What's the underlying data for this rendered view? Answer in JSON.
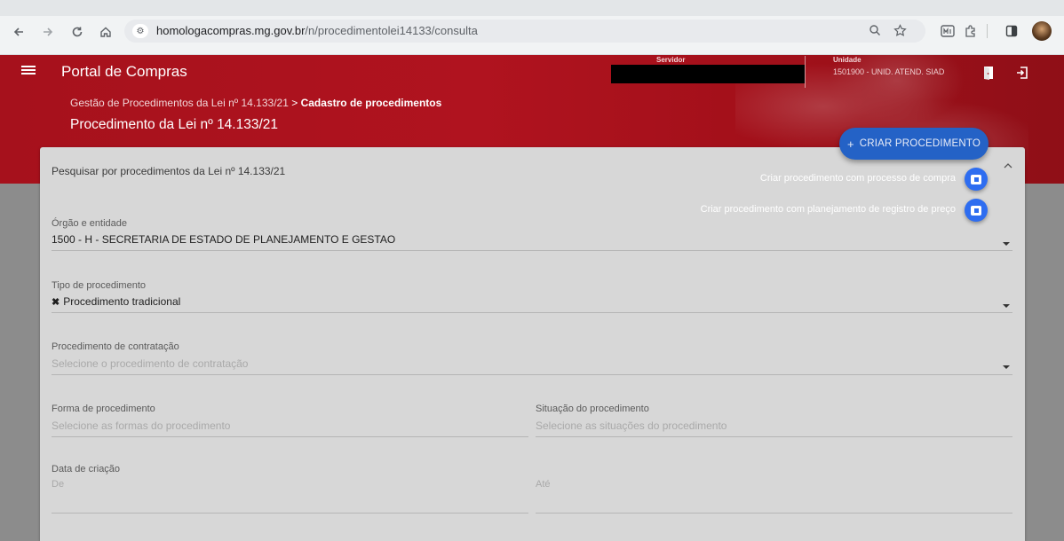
{
  "browser": {
    "url_domain": "homologacompras.mg.gov.br",
    "url_path": "/n/procedimentolei14133/consulta",
    "back_icon": "arrow-left-icon",
    "forward_icon": "arrow-right-icon",
    "reload_icon": "reload-icon",
    "home_icon": "home-icon"
  },
  "header": {
    "app_title": "Portal de Compras",
    "servidor_label": "Servidor",
    "unidade_label": "Unidade",
    "unidade_value": "1501900 - UNID. ATEND. SIAD",
    "breadcrumb_parent": "Gestão de Procedimentos da Lei nº 14.133/21",
    "breadcrumb_separator": ">",
    "breadcrumb_current": "Cadastro de procedimentos",
    "page_title": "Procedimento da Lei nº 14.133/21"
  },
  "card": {
    "title": "Pesquisar por procedimentos da Lei nº 14.133/21"
  },
  "form": {
    "orgao_label": "Órgão e entidade",
    "orgao_value": "1500 - H - SECRETARIA DE ESTADO DE PLANEJAMENTO E GESTAO",
    "tipo_label": "Tipo de procedimento",
    "tipo_chip_remove": "✖",
    "tipo_value": "Procedimento tradicional",
    "contratacao_label": "Procedimento de contratação",
    "contratacao_placeholder": "Selecione o procedimento de contratação",
    "forma_label": "Forma de procedimento",
    "forma_placeholder": "Selecione as formas do procedimento",
    "situacao_label": "Situação do procedimento",
    "situacao_placeholder": "Selecione as situações do procedimento",
    "data_label": "Data de criação",
    "de_placeholder": "De",
    "ate_placeholder": "Até"
  },
  "speed_dial": {
    "plus": "+",
    "main_label": "CRIAR PROCEDIMENTO",
    "action_1_label": "Criar procedimento com processo de compra",
    "action_2_label": "Criar procedimento com planejamento de registro de preço"
  },
  "colors": {
    "header_red": "#a6111c",
    "fab_blue": "#2462c6"
  }
}
